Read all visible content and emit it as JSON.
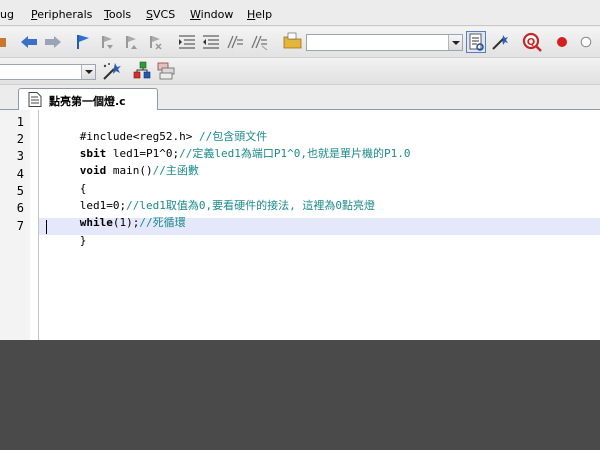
{
  "menu": [
    {
      "pre": "",
      "acc": "",
      "post": "ug"
    },
    {
      "pre": "",
      "acc": "P",
      "post": "eripherals"
    },
    {
      "pre": "",
      "acc": "T",
      "post": "ools"
    },
    {
      "pre": "",
      "acc": "S",
      "post": "VCS"
    },
    {
      "pre": "",
      "acc": "W",
      "post": "indow"
    },
    {
      "pre": "",
      "acc": "H",
      "post": "elp"
    }
  ],
  "editor_tab": {
    "filename": "點亮第一個燈.c"
  },
  "colors": {
    "comment": "#1c8a8a",
    "current_line": "#e5e8fa",
    "desktop": "#4a4a4a"
  },
  "icons": [
    "back-arrow-icon",
    "forward-arrow-icon",
    "bookmark-flag-icon",
    "prev-bookmark-icon",
    "next-bookmark-icon",
    "clear-bookmarks-icon",
    "indent-icon",
    "unindent-icon",
    "comment-icon",
    "uncomment-icon",
    "find-in-files-icon",
    "build-icon",
    "debug-icon",
    "run-icon",
    "stop-icon",
    "wizard-icon",
    "manage-icon",
    "pack-icon"
  ],
  "code": {
    "line_numbers": [
      "1",
      "2",
      "3",
      "4",
      "5",
      "6",
      "7"
    ],
    "lines": [
      [
        {
          "t": "#include<reg52.h> ",
          "c": "tx"
        },
        {
          "t": "//包含頭文件",
          "c": "cm"
        }
      ],
      [
        {
          "t": "sbit",
          "c": "kw"
        },
        {
          "t": " led1=P1^0;",
          "c": "tx"
        },
        {
          "t": "//定義led1為端口P1^0,也就是單片機的P1.0",
          "c": "cm"
        }
      ],
      [
        {
          "t": "void",
          "c": "kw"
        },
        {
          "t": " main()",
          "c": "tx"
        },
        {
          "t": "//主函數",
          "c": "cm"
        }
      ],
      [
        {
          "t": "{",
          "c": "tx"
        }
      ],
      [
        {
          "t": "led1=0;",
          "c": "tx"
        },
        {
          "t": "//led1取值為0,要看硬件的接法, 這裡為0點亮燈",
          "c": "cm"
        }
      ],
      [
        {
          "t": "while",
          "c": "kw"
        },
        {
          "t": "(1);",
          "c": "tx"
        },
        {
          "t": "//死循環",
          "c": "cm"
        }
      ],
      [
        {
          "t": "}",
          "c": "tx"
        }
      ]
    ]
  }
}
